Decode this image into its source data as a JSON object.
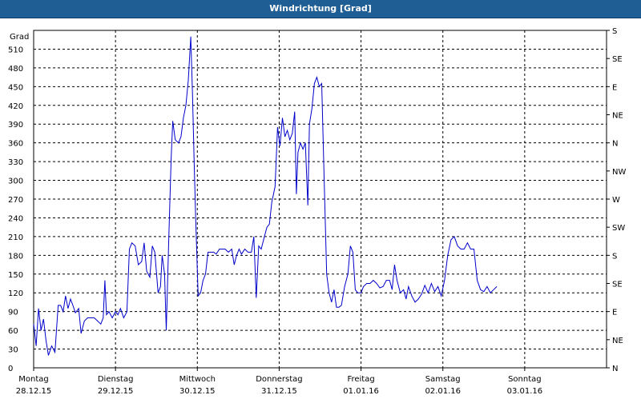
{
  "window": {
    "title": "Windrichtung [Grad]"
  },
  "chart_data": {
    "type": "line",
    "title": "Windrichtung [Grad]",
    "ylabel": "Grad",
    "ylim": [
      0,
      540
    ],
    "yticks": [
      0,
      30,
      60,
      90,
      120,
      150,
      180,
      210,
      240,
      270,
      300,
      330,
      360,
      390,
      420,
      450,
      480,
      510
    ],
    "right_axis_labels": [
      {
        "value": 0,
        "label": "N"
      },
      {
        "value": 30,
        "label": "NE"
      },
      {
        "value": 60,
        "label": "E"
      },
      {
        "value": 90,
        "label": "SE"
      },
      {
        "value": 120,
        "label": "S"
      },
      {
        "value": 150,
        "label": "SW"
      },
      {
        "value": 180,
        "label": "W"
      },
      {
        "value": 210,
        "label": "NW"
      },
      {
        "value": 240,
        "label": "N"
      },
      {
        "value": 270,
        "label": "NE"
      },
      {
        "value": 300,
        "label": "E"
      },
      {
        "value": 330,
        "label": "SE"
      },
      {
        "value": 360,
        "label": "S"
      }
    ],
    "xlim": [
      0,
      7
    ],
    "days": [
      {
        "day": "Montag",
        "date": "28.12.15"
      },
      {
        "day": "Dienstag",
        "date": "29.12.15"
      },
      {
        "day": "Mittwoch",
        "date": "30.12.15"
      },
      {
        "day": "Donnerstag",
        "date": "31.12.15"
      },
      {
        "day": "Freitag",
        "date": "01.01.16"
      },
      {
        "day": "Samstag",
        "date": "02.01.16"
      },
      {
        "day": "Sonntag",
        "date": "03.01.16"
      }
    ],
    "grid": true,
    "color": "#0000cc",
    "series": [
      {
        "values": [
          [
            0.0,
            70
          ],
          [
            0.03,
            35
          ],
          [
            0.06,
            95
          ],
          [
            0.09,
            60
          ],
          [
            0.12,
            78
          ],
          [
            0.15,
            45
          ],
          [
            0.18,
            20
          ],
          [
            0.22,
            35
          ],
          [
            0.26,
            25
          ],
          [
            0.3,
            100
          ],
          [
            0.33,
            100
          ],
          [
            0.36,
            90
          ],
          [
            0.39,
            115
          ],
          [
            0.42,
            95
          ],
          [
            0.45,
            110
          ],
          [
            0.48,
            100
          ],
          [
            0.51,
            88
          ],
          [
            0.55,
            95
          ],
          [
            0.58,
            55
          ],
          [
            0.62,
            75
          ],
          [
            0.66,
            80
          ],
          [
            0.7,
            80
          ],
          [
            0.74,
            80
          ],
          [
            0.78,
            75
          ],
          [
            0.82,
            70
          ],
          [
            0.85,
            80
          ],
          [
            0.87,
            140
          ],
          [
            0.89,
            85
          ],
          [
            0.92,
            90
          ],
          [
            0.96,
            80
          ],
          [
            1.0,
            90
          ],
          [
            1.03,
            85
          ],
          [
            1.06,
            95
          ],
          [
            1.1,
            80
          ],
          [
            1.14,
            90
          ],
          [
            1.17,
            190
          ],
          [
            1.2,
            200
          ],
          [
            1.24,
            195
          ],
          [
            1.28,
            165
          ],
          [
            1.32,
            170
          ],
          [
            1.35,
            200
          ],
          [
            1.38,
            155
          ],
          [
            1.42,
            145
          ],
          [
            1.45,
            195
          ],
          [
            1.48,
            185
          ],
          [
            1.52,
            120
          ],
          [
            1.55,
            130
          ],
          [
            1.57,
            180
          ],
          [
            1.6,
            150
          ],
          [
            1.62,
            60
          ],
          [
            1.65,
            200
          ],
          [
            1.68,
            335
          ],
          [
            1.7,
            395
          ],
          [
            1.73,
            365
          ],
          [
            1.77,
            360
          ],
          [
            1.8,
            370
          ],
          [
            1.83,
            400
          ],
          [
            1.86,
            420
          ],
          [
            1.89,
            460
          ],
          [
            1.92,
            530
          ],
          [
            1.94,
            440
          ],
          [
            1.96,
            335
          ],
          [
            1.98,
            240
          ],
          [
            2.01,
            115
          ],
          [
            2.04,
            120
          ],
          [
            2.07,
            140
          ],
          [
            2.1,
            150
          ],
          [
            2.13,
            185
          ],
          [
            2.16,
            185
          ],
          [
            2.2,
            185
          ],
          [
            2.23,
            182
          ],
          [
            2.27,
            190
          ],
          [
            2.3,
            190
          ],
          [
            2.34,
            190
          ],
          [
            2.38,
            185
          ],
          [
            2.42,
            190
          ],
          [
            2.45,
            165
          ],
          [
            2.48,
            180
          ],
          [
            2.51,
            190
          ],
          [
            2.54,
            182
          ],
          [
            2.58,
            190
          ],
          [
            2.62,
            185
          ],
          [
            2.66,
            185
          ],
          [
            2.69,
            210
          ],
          [
            2.72,
            112
          ],
          [
            2.75,
            195
          ],
          [
            2.78,
            190
          ],
          [
            2.81,
            205
          ],
          [
            2.85,
            225
          ],
          [
            2.88,
            230
          ],
          [
            2.91,
            265
          ],
          [
            2.95,
            290
          ],
          [
            2.98,
            385
          ],
          [
            3.01,
            355
          ],
          [
            3.04,
            400
          ],
          [
            3.07,
            370
          ],
          [
            3.1,
            380
          ],
          [
            3.13,
            365
          ],
          [
            3.16,
            375
          ],
          [
            3.19,
            410
          ],
          [
            3.21,
            278
          ],
          [
            3.23,
            345
          ],
          [
            3.26,
            360
          ],
          [
            3.29,
            350
          ],
          [
            3.32,
            360
          ],
          [
            3.35,
            260
          ],
          [
            3.37,
            390
          ],
          [
            3.4,
            415
          ],
          [
            3.43,
            455
          ],
          [
            3.46,
            465
          ],
          [
            3.49,
            450
          ],
          [
            3.52,
            455
          ],
          [
            3.55,
            300
          ],
          [
            3.58,
            150
          ],
          [
            3.61,
            120
          ],
          [
            3.64,
            105
          ],
          [
            3.67,
            125
          ],
          [
            3.7,
            97
          ],
          [
            3.73,
            97
          ],
          [
            3.76,
            100
          ],
          [
            3.8,
            130
          ],
          [
            3.84,
            150
          ],
          [
            3.87,
            195
          ],
          [
            3.9,
            185
          ],
          [
            3.93,
            125
          ],
          [
            3.96,
            120
          ],
          [
            4.0,
            120
          ],
          [
            4.03,
            130
          ],
          [
            4.07,
            135
          ],
          [
            4.11,
            135
          ],
          [
            4.15,
            140
          ],
          [
            4.19,
            135
          ],
          [
            4.23,
            128
          ],
          [
            4.27,
            130
          ],
          [
            4.31,
            140
          ],
          [
            4.35,
            140
          ],
          [
            4.38,
            125
          ],
          [
            4.41,
            165
          ],
          [
            4.44,
            140
          ],
          [
            4.48,
            120
          ],
          [
            4.52,
            125
          ],
          [
            4.55,
            110
          ],
          [
            4.58,
            130
          ],
          [
            4.62,
            115
          ],
          [
            4.66,
            105
          ],
          [
            4.7,
            110
          ],
          [
            4.74,
            118
          ],
          [
            4.78,
            132
          ],
          [
            4.82,
            120
          ],
          [
            4.86,
            135
          ],
          [
            4.9,
            122
          ],
          [
            4.94,
            130
          ],
          [
            4.98,
            115
          ],
          [
            5.02,
            140
          ],
          [
            5.06,
            180
          ],
          [
            5.1,
            205
          ],
          [
            5.14,
            210
          ],
          [
            5.18,
            195
          ],
          [
            5.22,
            190
          ],
          [
            5.26,
            190
          ],
          [
            5.3,
            200
          ],
          [
            5.34,
            190
          ],
          [
            5.38,
            190
          ],
          [
            5.42,
            140
          ],
          [
            5.46,
            125
          ],
          [
            5.5,
            122
          ],
          [
            5.54,
            130
          ],
          [
            5.58,
            120
          ],
          [
            5.62,
            125
          ],
          [
            5.66,
            130
          ]
        ]
      }
    ]
  }
}
